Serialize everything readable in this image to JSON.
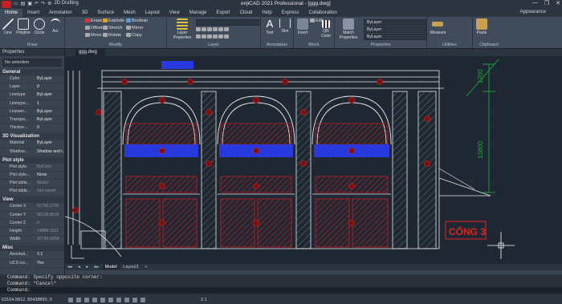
{
  "app": {
    "title": "enjiCAD 2021 Professional - [ggg.dwg]",
    "workspace": "2D Drafting",
    "window_controls": [
      "—",
      "❐",
      "✕"
    ]
  },
  "ribbon_tabs": [
    "Home",
    "Insert",
    "Annotation",
    "3D",
    "Surface",
    "Mesh",
    "Layout",
    "View",
    "Manage",
    "Export",
    "Cloud",
    "Help",
    "Express",
    "Collaboration"
  ],
  "appearance_label": "Appearance",
  "ribbon": {
    "draw": {
      "label": "Draw",
      "buttons": [
        "Line",
        "Polyline",
        "Circle",
        "Arc"
      ]
    },
    "modify": {
      "label": "Modify",
      "rows": [
        [
          "Erase",
          "Explode",
          "Boolean"
        ],
        [
          "Offset",
          "Stretch",
          "Mirror"
        ],
        [
          "Move",
          "Rotate",
          "Copy"
        ]
      ]
    },
    "layers": {
      "label": "Layer",
      "big_button": "Layer Properties"
    },
    "annotation": {
      "label": "Annotation",
      "buttons": [
        "Text",
        "Dim"
      ]
    },
    "block": {
      "label": "Block",
      "buttons": [
        "Insert",
        "Edit",
        "QR Code"
      ]
    },
    "properties": {
      "label": "Properties",
      "big_button": "Match Properties",
      "combos": [
        "ByLayer",
        "ByLayer",
        "ByLayer"
      ]
    },
    "utilities": {
      "label": "Utilities",
      "big_button": "Measure"
    },
    "clipboard": {
      "label": "Clipboard",
      "big_button": "Paste"
    }
  },
  "properties_panel": {
    "header": "Properties",
    "selection": "No selection",
    "sections": [
      {
        "name": "General",
        "rows": [
          {
            "k": "Color",
            "v": "ByLayer"
          },
          {
            "k": "Layer",
            "v": "0"
          },
          {
            "k": "Linetype",
            "v": "ByLayer"
          },
          {
            "k": "Linetype...",
            "v": "1"
          },
          {
            "k": "Linewei...",
            "v": "ByLayer"
          },
          {
            "k": "Transpa...",
            "v": "ByLayer"
          },
          {
            "k": "Thickne...",
            "v": "0"
          }
        ]
      },
      {
        "name": "3D Visualization",
        "rows": [
          {
            "k": "Material",
            "v": "ByLayer"
          },
          {
            "k": "Shadow...",
            "v": "Shadow and r..."
          }
        ]
      },
      {
        "name": "Plot style",
        "rows": [
          {
            "k": "Plot style",
            "v": "ByColor",
            "dim": true
          },
          {
            "k": "Plot style...",
            "v": "None"
          },
          {
            "k": "Plot table...",
            "v": "Model",
            "dim": true
          },
          {
            "k": "Plot table...",
            "v": "Not saved",
            "dim": true
          }
        ]
      },
      {
        "name": "View",
        "rows": [
          {
            "k": "Center X",
            "v": "51742.2726",
            "dim": true
          },
          {
            "k": "Center Y",
            "v": "58128.8618",
            "dim": true
          },
          {
            "k": "Center Z",
            "v": "0",
            "dim": true
          },
          {
            "k": "Height",
            "v": "14888.1161",
            "dim": true
          },
          {
            "k": "Width",
            "v": "32740.0308",
            "dim": true
          }
        ]
      },
      {
        "name": "Misc",
        "rows": [
          {
            "k": "Annotati...",
            "v": "1:1"
          },
          {
            "k": "UCS ico...",
            "v": "Yes"
          }
        ]
      }
    ]
  },
  "document_tab": "ggg.dwg",
  "drawing": {
    "dim_top": "1200",
    "dim_side": "10800",
    "callout": "CỔNG 3"
  },
  "layout_tabs": [
    "Model",
    "Layout1"
  ],
  "command_lines": [
    "Command: Specify opposite corner:",
    "Command: *Cancel*",
    "Command:"
  ],
  "status": {
    "coords": "63164.5812, 60438893, 0",
    "scale": "1:1"
  },
  "colors": {
    "canvas": "#1f2733",
    "drawing_line": "#e8e8e8",
    "hatch_red": "#c8201e",
    "hatch_blue": "#1f2fd8",
    "dim_green": "#1fa83a",
    "callout_red": "#e0231f"
  }
}
